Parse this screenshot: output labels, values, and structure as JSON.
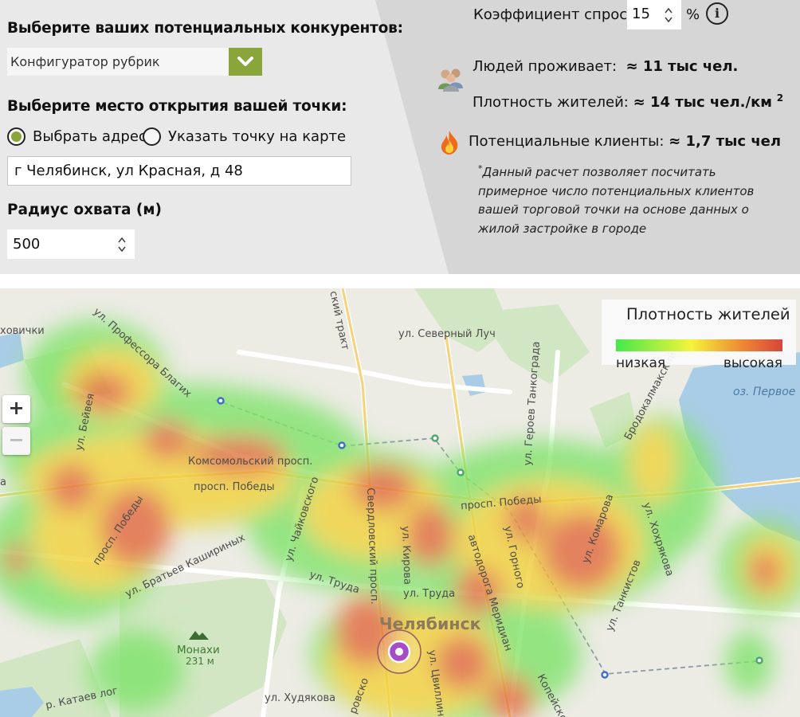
{
  "form": {
    "competitors_label": "Выберите ваших потенциальных конкурентов:",
    "rubric_select": "Конфигуратор рубрик",
    "location_label": "Выберите место открытия вашей точки:",
    "radio_address": "Выбрать адрес",
    "radio_map_point": "Указать точку на карте",
    "selected_mode": "address",
    "address_value": "г Челябинск, ул Красная, д 48",
    "radius_label": "Радиус охвата (м)",
    "radius_value": "500"
  },
  "demand": {
    "label": "Коэффициент спроса:",
    "value": "15",
    "unit": "%",
    "info_icon": "i"
  },
  "stats": {
    "people_label": "Людей проживает:",
    "people_value": "≈ 11 тыс чел.",
    "density_label": "Плотность жителей:",
    "density_value": "≈ 14 тыс чел./км",
    "density_power": "2",
    "clients_label": "Потенциальные клиенты:",
    "clients_value": "≈ 1,7 тыс чел",
    "note_mark": "*",
    "note_text": "Данный расчет позволяет посчитать примерное число потенциальных клиентов вашей торговой точки на основе данных о жилой застройке в городе"
  },
  "map": {
    "zoom_in": "+",
    "zoom_out": "−",
    "zoom_out_enabled": false,
    "legend": {
      "title": "Плотность жителей",
      "low": "низкая",
      "high": "высокая",
      "colors": [
        "#44e84b",
        "#f4f43a",
        "#ef8a33",
        "#d8443c"
      ]
    },
    "city": "Челябинск",
    "lake": "оз. Первое",
    "hill_name": "Монахи",
    "hill_height": "231 м",
    "streets": {
      "north_tract": "ский тракт",
      "severny_luch": "ул. Северный Луч",
      "blagikh": "ул. Профессора Благих",
      "beyveya": "ул. Бейвея",
      "komsomolsky": "Комсомольский просп.",
      "pobedy_w": "просп. Победы",
      "pobedy_sw": "просп. Победы",
      "pobedy_e": "просп. Победы",
      "chaikovskogo": "ул. Чайковского",
      "sverdlovsky": "Свердловский просп.",
      "kirova": "ул. Кирова",
      "bratiev": "ул. Братьев Кашириных",
      "truda_w": "ул. Труда",
      "truda_c": "ул. Труда",
      "geroev": "ул. Героев Танкограда",
      "brodokalmaksky": "Бродокалмакский",
      "khokhryakova": "ул. Хохрякова",
      "gornogo": "ул. Горного",
      "komarova": "ул. Комарова",
      "meridian": "автодорога Меридиан",
      "tankistov": "ул. Танкистов",
      "tsvillinga": "ул. Цвиллинга",
      "khudyakova": "ул. Худякова",
      "kataev": "р. Катаев лог",
      "kopeyskoe": "Копейское",
      "sverdlovsky_s": "ровско",
      "west_edge": "ховички",
      "west_edge2": "а"
    }
  }
}
